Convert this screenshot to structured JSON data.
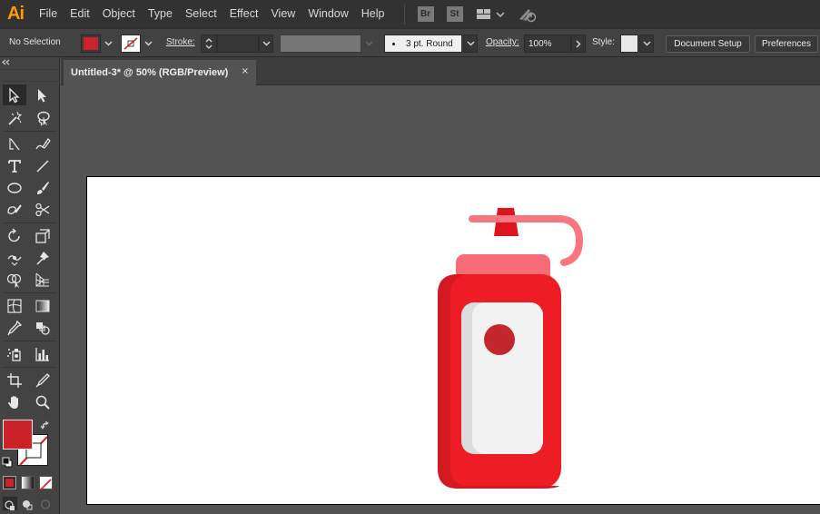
{
  "app": {
    "logo_text": "Ai",
    "menu": [
      "File",
      "Edit",
      "Object",
      "Type",
      "Select",
      "Effect",
      "View",
      "Window",
      "Help"
    ],
    "badges": [
      "Br",
      "St"
    ]
  },
  "control_bar": {
    "selection_label": "No Selection",
    "fill_color": "#cc2229",
    "stroke_label": "Stroke:",
    "stroke_weight_value": "",
    "brush_value": "3 pt. Round",
    "opacity_label": "Opacity:",
    "opacity_value": "100%",
    "style_label": "Style:",
    "document_setup_label": "Document Setup",
    "preferences_label": "Preferences"
  },
  "document": {
    "tab_title": "Untitled-3* @ 50% (RGB/Preview)",
    "close_glyph": "×"
  },
  "tools_panel": {
    "fill_color": "#cc2229",
    "tools": [
      "selection-tool",
      "direct-selection-tool",
      "magic-wand-tool",
      "lasso-tool",
      "pen-tool",
      "curvature-tool",
      "type-tool",
      "line-segment-tool",
      "ellipse-tool",
      "paintbrush-tool",
      "shaper-tool",
      "scissors-tool",
      "rotate-tool",
      "free-transform-tool",
      "width-tool",
      "puppet-warp-tool",
      "shape-builder-tool",
      "perspective-grid-tool",
      "mesh-tool",
      "gradient-tool",
      "eyedropper-tool",
      "blend-tool",
      "symbol-sprayer-tool",
      "column-graph-tool",
      "artboard-tool",
      "slice-tool",
      "hand-tool",
      "zoom-tool"
    ]
  },
  "artwork": {
    "colors": {
      "body": "#ee1c25",
      "body_shade": "#d51920",
      "neck": "#f66b76",
      "nozzle": "#e0141d",
      "cap_loop": "#f87680",
      "label": "#f2f2f2",
      "label_shade": "#dcdcdc",
      "dot": "#c1272d"
    }
  }
}
